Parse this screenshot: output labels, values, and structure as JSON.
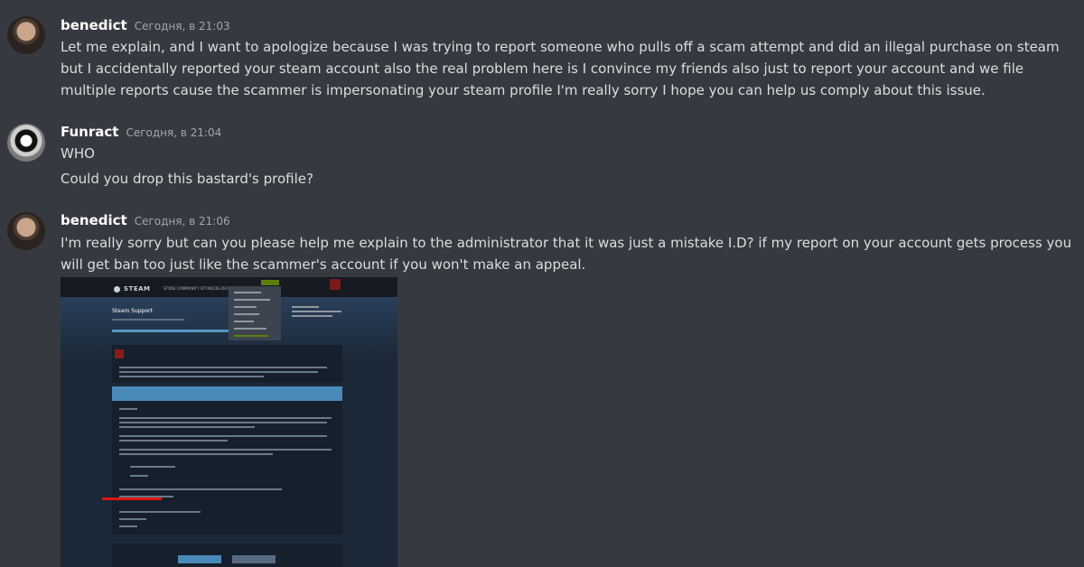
{
  "messages": [
    {
      "username": "benedict",
      "timestamp": "Сегодня, в 21:03",
      "lines": [
        "Let me explain, and I want to apologize because I was trying to report someone who pulls off a scam attempt and did an illegal purchase on steam but I accidentally reported your steam account also the real problem here is I convince my friends also just to report your account and we file multiple reports cause the scammer is impersonating your steam profile I'm really sorry I hope you can help us comply about this issue."
      ]
    },
    {
      "username": "Funract",
      "timestamp": "Сегодня, в 21:04",
      "lines": [
        "WHO",
        "Could you drop this bastard's profile?"
      ]
    },
    {
      "username": "benedict",
      "timestamp": "Сегодня, в 21:06",
      "lines": [
        "I'm really sorry but can you please help me explain to the administrator that it was just a mistake I.D? if my report on your account gets process you will get ban too just like the scammer's account if you won't make an appeal."
      ],
      "attachment": {
        "logo": "STEAM",
        "nav": "STORE  COMMUNITY  STYXIOCIB-ZEO",
        "page_title": "Steam Support"
      }
    }
  ],
  "colors": {
    "background": "#36393f",
    "username": "#ffffff",
    "text": "#dcddde",
    "timestamp": "#a3a6aa"
  }
}
